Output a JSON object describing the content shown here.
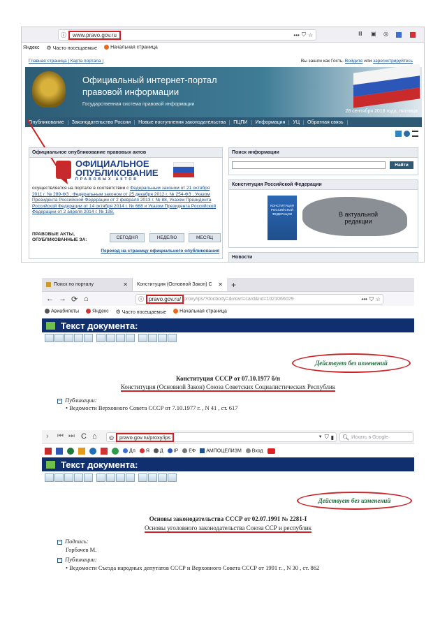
{
  "shot1": {
    "url": "www.pravo.gov.ru",
    "bookmarks": [
      "Яндекс",
      "Часто посещаемые",
      "Начальная страница"
    ],
    "topnav": {
      "left": "Главная страница | Карта портала |",
      "right_prefix": "Вы зашли как Гость.",
      "login": "Войдите",
      "or": "или",
      "register": "зарегистрируйтесь"
    },
    "title_line1": "Официальный интернет-портал",
    "title_line2": "правовой информации",
    "subtitle": "Государственная система правовой информации",
    "date": "28 сентября 2018 года, пятница",
    "menu": [
      "Опубликование",
      "Законодательство России",
      "Новые поступления законодательства",
      "ПЦПИ",
      "Информация",
      "УЦ",
      "Обратная связь"
    ],
    "publish_panel": {
      "heading": "Официальное опубликование правовых актов",
      "logo_line1": "ОФИЦИАЛЬНОЕ",
      "logo_line2": "ОПУБЛИКОВАНИЕ",
      "logo_line3": "ПРАВОВЫХ АКТОВ",
      "text_plain": "осуществляется на портале в соответствии с",
      "law_links": "Федеральным законом от 21 октября 2011 г. № 289-ФЗ , Федеральным законом от 25 декабря 2012 г. № 254-ФЗ , Указом Президента Российской Федерации от 2 февраля 2013 г. № 88, Указом Президента Российской Федерации от 14 октября 2014 г. № 668 и Указом Президента Российской Федерации от 2 апреля 2014 г. № 198.",
      "acts_label": "ПРАВОВЫЕ АКТЫ, ОПУБЛИКОВАННЫЕ ЗА:",
      "buttons": [
        "СЕГОДНЯ",
        "НЕДЕЛЮ",
        "МЕСЯЦ"
      ],
      "goto_link": "Переход на страницу официального опубликования"
    },
    "search_panel": {
      "heading": "Поиск информации",
      "button": "Найти"
    },
    "constitution_panel": {
      "heading": "Конституция Российской Федерации",
      "book_title": "КОНСТИТУЦИЯ РОССИЙСКОЙ ФЕДЕРАЦИИ",
      "map_text": "В актуальной редакции"
    },
    "news_heading": "Новости"
  },
  "shot2": {
    "tabs": [
      "Поиск по порталу",
      "Конституция (Основной Закон) С"
    ],
    "url_domain": "pravo.gov.ru/",
    "url_rest": "proxy/ips/?docbody=&vkart=card&nd=1021066029",
    "bookmarks": [
      "Авиабилеты",
      "Яндекс",
      "Часто посещаемые",
      "Начальная страница"
    ],
    "doc_header": "Текст документа:",
    "status": "Действует без изменений",
    "doc_title": "Конституция СССР от 07.10.1977 б/н",
    "doc_subtitle": "Конституция (Основной Закон) Союза Советских Социалистических Республик",
    "pubs_label": "Публикации:",
    "pub_item": "Ведомости Верховного Совета СССР от 7.10.1977 г. , N 41 , ст. 617"
  },
  "shot3": {
    "url": "pravo.gov.ru/proxy/ips",
    "search_placeholder": "Искать в Google",
    "bookmarks": [
      "Дл",
      "Я",
      "Д",
      "IP",
      "ЕФ",
      "АМПОЦЕЛИЗМ",
      "Вход"
    ],
    "doc_header": "Текст документа:",
    "status": "Действует без изменений",
    "doc_title": "Основы законодательства СССР от 02.07.1991 № 2281-I",
    "doc_subtitle": "Основы уголовного законодательства Союза ССР и республик",
    "signature_label": "Подпись:",
    "signature_value": "Горбачев М.",
    "pubs_label": "Публикации:",
    "pub_item": "Ведомости Съезда народных депутатов СССР и Верховного Совета СССР от 1991 г. , N 30 , ст. 862"
  },
  "colors": {
    "accent_red": "#cc1f1f",
    "nav_blue": "#2f5a75",
    "doc_blue": "#0f2f6f",
    "status_green": "#1c6a3a"
  }
}
